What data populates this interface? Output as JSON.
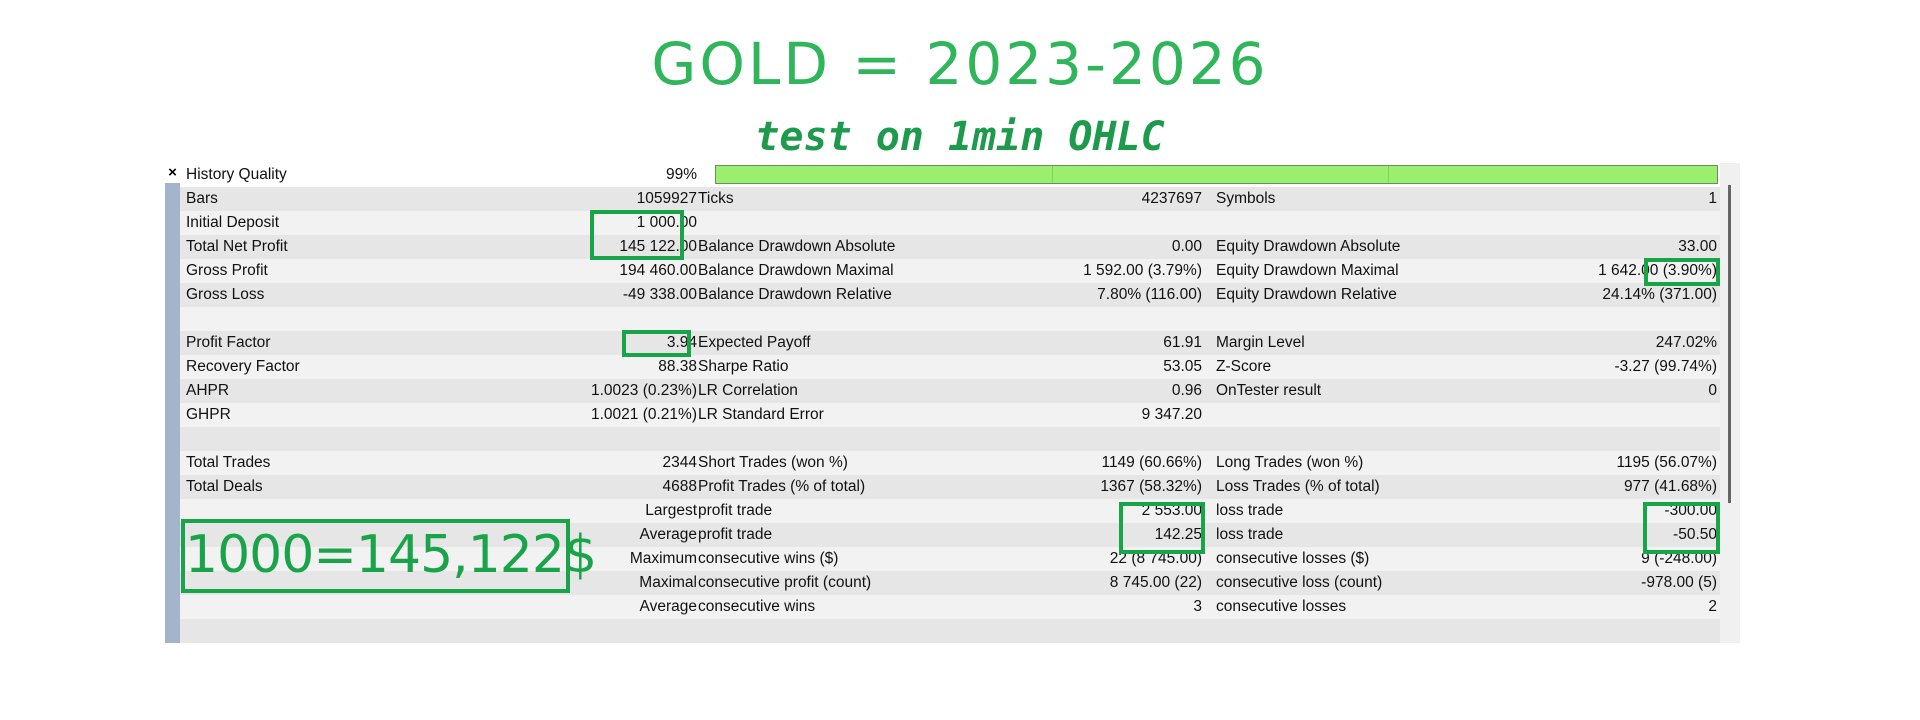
{
  "title": "GOLD = 2023-2026",
  "subtitle": "test on 1min OHLC",
  "handnote": "1000=145,122$",
  "close_label": "×",
  "colors": {
    "annotation": "#1aa44a",
    "quality_bar": "#9bef6e",
    "side_bar": "#a2b5cc"
  },
  "history_quality": {
    "label": "History Quality",
    "value": "99%",
    "fraction": 0.99
  },
  "rows": [
    {
      "c1": [
        "Bars",
        "1059927"
      ],
      "c2": [
        "Ticks",
        "4237697"
      ],
      "c3": [
        "Symbols",
        "1"
      ]
    },
    {
      "c1": [
        "Initial Deposit",
        "1 000.00"
      ],
      "c2": [
        "",
        ""
      ],
      "c3": [
        "",
        ""
      ]
    },
    {
      "c1": [
        "Total Net Profit",
        "145 122.00"
      ],
      "c2": [
        "Balance Drawdown Absolute",
        "0.00"
      ],
      "c3": [
        "Equity Drawdown Absolute",
        "33.00"
      ]
    },
    {
      "c1": [
        "Gross Profit",
        "194 460.00"
      ],
      "c2": [
        "Balance Drawdown Maximal",
        "1 592.00 (3.79%)"
      ],
      "c3": [
        "Equity Drawdown Maximal",
        "1 642.00 (3.90%)"
      ]
    },
    {
      "c1": [
        "Gross Loss",
        "-49 338.00"
      ],
      "c2": [
        "Balance Drawdown Relative",
        "7.80% (116.00)"
      ],
      "c3": [
        "Equity Drawdown Relative",
        "24.14% (371.00)"
      ]
    },
    {
      "c1": [
        "",
        ""
      ],
      "c2": [
        "",
        ""
      ],
      "c3": [
        "",
        ""
      ]
    },
    {
      "c1": [
        "Profit Factor",
        "3.94"
      ],
      "c2": [
        "Expected Payoff",
        "61.91"
      ],
      "c3": [
        "Margin Level",
        "247.02%"
      ]
    },
    {
      "c1": [
        "Recovery Factor",
        "88.38"
      ],
      "c2": [
        "Sharpe Ratio",
        "53.05"
      ],
      "c3": [
        "Z-Score",
        "-3.27 (99.74%)"
      ]
    },
    {
      "c1": [
        "AHPR",
        "1.0023 (0.23%)"
      ],
      "c2": [
        "LR Correlation",
        "0.96"
      ],
      "c3": [
        "OnTester result",
        "0"
      ]
    },
    {
      "c1": [
        "GHPR",
        "1.0021 (0.21%)"
      ],
      "c2": [
        "LR Standard Error",
        "9 347.20"
      ],
      "c3": [
        "",
        ""
      ]
    },
    {
      "c1": [
        "",
        ""
      ],
      "c2": [
        "",
        ""
      ],
      "c3": [
        "",
        ""
      ]
    },
    {
      "c1": [
        "Total Trades",
        "2344"
      ],
      "c2": [
        "Short Trades (won %)",
        "1149 (60.66%)"
      ],
      "c3": [
        "Long Trades (won %)",
        "1195 (56.07%)"
      ]
    },
    {
      "c1": [
        "Total Deals",
        "4688"
      ],
      "c2": [
        "Profit Trades (% of total)",
        "1367 (58.32%)"
      ],
      "c3": [
        "Loss Trades (% of total)",
        "977 (41.68%)"
      ]
    },
    {
      "c1": [
        "",
        "Largest"
      ],
      "c2": [
        "profit trade",
        "2 553.00"
      ],
      "c3": [
        "loss trade",
        "-300.00"
      ]
    },
    {
      "c1": [
        "",
        "Average"
      ],
      "c2": [
        "profit trade",
        "142.25"
      ],
      "c3": [
        "loss trade",
        "-50.50"
      ]
    },
    {
      "c1": [
        "",
        "Maximum"
      ],
      "c2": [
        "consecutive wins ($)",
        "22 (8 745.00)"
      ],
      "c3": [
        "consecutive losses ($)",
        "9 (-248.00)"
      ]
    },
    {
      "c1": [
        "",
        "Maximal"
      ],
      "c2": [
        "consecutive profit (count)",
        "8 745.00 (22)"
      ],
      "c3": [
        "consecutive loss (count)",
        "-978.00 (5)"
      ]
    },
    {
      "c1": [
        "",
        "Average"
      ],
      "c2": [
        "consecutive wins",
        "3"
      ],
      "c3": [
        "consecutive losses",
        "2"
      ]
    },
    {
      "c1": [
        "",
        ""
      ],
      "c2": [
        "",
        ""
      ],
      "c3": [
        "",
        ""
      ]
    }
  ]
}
